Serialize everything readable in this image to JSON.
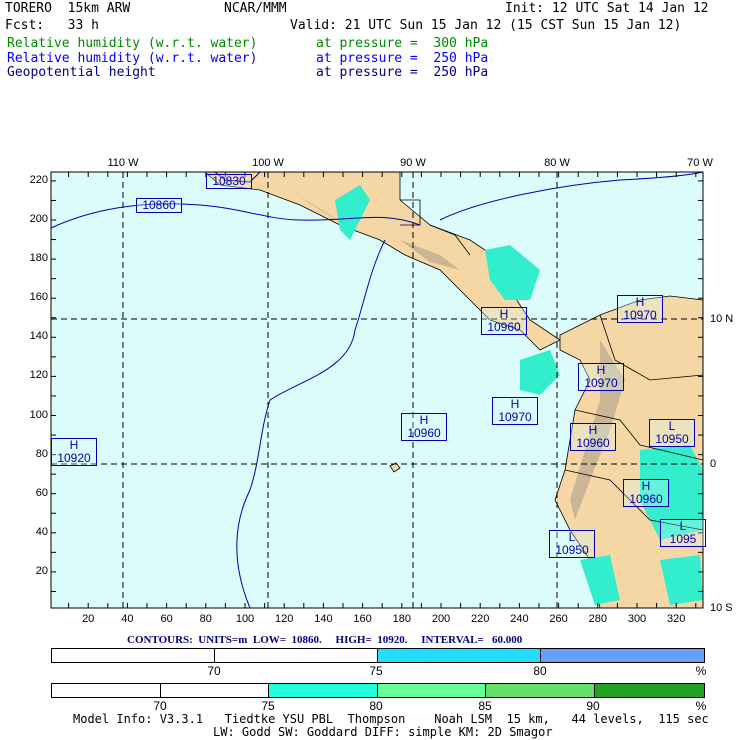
{
  "header": {
    "model": "TORERO  15km ARW",
    "org": "NCAR/MMM",
    "init": "Init: 12 UTC Sat 14 Jan 12",
    "fcst": "Fcst:   33 h",
    "valid": "Valid: 21 UTC Sun 15 Jan 12 (15 CST Sun 15 Jan 12)",
    "fields": [
      {
        "name": "Relative humidity (w.r.t. water)",
        "level": "at pressure =  300 hPa",
        "color": "#008800"
      },
      {
        "name": "Relative humidity (w.r.t. water)",
        "level": "at pressure =  250 hPa",
        "color": "#0000ff"
      },
      {
        "name": "Geopotential height",
        "level": "at pressure =  250 hPa",
        "color": "#000080"
      }
    ]
  },
  "map": {
    "top_lon_labels": [
      "110 W",
      "100 W",
      "90 W",
      "80 W",
      "70 W"
    ],
    "right_lat_labels": [
      "10 N",
      "0",
      "10 S"
    ],
    "x_ticks": [
      "20",
      "40",
      "60",
      "80",
      "100",
      "120",
      "140",
      "160",
      "180",
      "200",
      "220",
      "240",
      "260",
      "280",
      "300",
      "320"
    ],
    "y_ticks": [
      "220",
      "200",
      "180",
      "160",
      "140",
      "120",
      "100",
      "80",
      "60",
      "40",
      "20"
    ],
    "contour_labels": [
      {
        "sym": "",
        "val": "10830"
      },
      {
        "sym": "",
        "val": "10860"
      },
      {
        "sym": "H",
        "val": "10960"
      },
      {
        "sym": "H",
        "val": "10970"
      },
      {
        "sym": "H",
        "val": "10970"
      },
      {
        "sym": "H",
        "val": "10970"
      },
      {
        "sym": "H",
        "val": "10960"
      },
      {
        "sym": "H",
        "val": "10960"
      },
      {
        "sym": "L",
        "val": "10950"
      },
      {
        "sym": "H",
        "val": "10920"
      },
      {
        "sym": "H",
        "val": "10960"
      },
      {
        "sym": "L",
        "val": "10950"
      },
      {
        "sym": "L",
        "val": "1095"
      }
    ]
  },
  "contour_info": "CONTOURS:  UNITS=m  LOW=  10860.     HIGH=  10920.     INTERVAL=   60.000",
  "colorbar_250": {
    "labels": [
      "70",
      "75",
      "80",
      "%"
    ],
    "colors": [
      "#ffffff",
      "#ffffff",
      "#22ddff",
      "#66a0ff"
    ]
  },
  "colorbar_300": {
    "labels": [
      "70",
      "75",
      "80",
      "85",
      "90",
      "%"
    ],
    "colors": [
      "#ffffff",
      "#ffffff",
      "#22ffdd",
      "#66ff99",
      "#66dd66",
      "#22a022"
    ]
  },
  "model_info": {
    "line1": "Model Info: V3.3.1   Tiedtke YSU PBL  Thompson    Noah LSM  15 km,   44 levels,  115 sec",
    "line2": "LW: Godd SW: Goddard DIFF: simple KM: 2D Smagor"
  }
}
